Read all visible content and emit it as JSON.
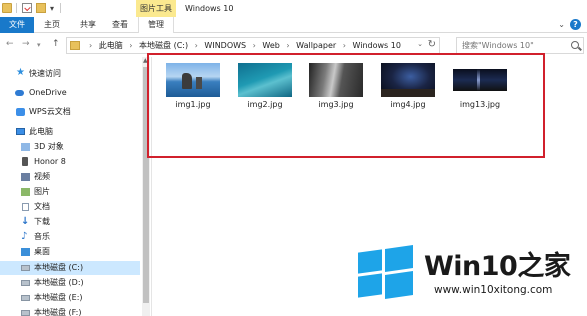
{
  "window": {
    "title": "Windows 10",
    "context_tab": "图片工具"
  },
  "quick_access": {
    "dropdown_glyph": "▾"
  },
  "ribbon": {
    "tabs": [
      {
        "label": "文件"
      },
      {
        "label": "主页"
      },
      {
        "label": "共享"
      },
      {
        "label": "查看"
      },
      {
        "label": "管理"
      }
    ],
    "expand_glyph": "⌄",
    "help_glyph": "?"
  },
  "nav_buttons": {
    "back": "←",
    "forward": "→",
    "recent": "▾",
    "up": "↑"
  },
  "address": {
    "crumbs": [
      "此电脑",
      "本地磁盘 (C:)",
      "WINDOWS",
      "Web",
      "Wallpaper",
      "Windows 10"
    ],
    "separator": "›",
    "dropdown_glyph": "⌄",
    "refresh_glyph": "↻"
  },
  "search": {
    "placeholder": "搜索\"Windows 10\""
  },
  "sidebar": {
    "items": [
      {
        "label": "快速访问",
        "icon": "star-icon"
      },
      {
        "label": "OneDrive",
        "icon": "cloud-icon"
      },
      {
        "label": "WPS云文档",
        "icon": "wps-cloud-icon"
      },
      {
        "label": "此电脑",
        "icon": "computer-icon"
      },
      {
        "label": "3D 对象",
        "icon": "cube-icon"
      },
      {
        "label": "Honor 8",
        "icon": "phone-icon"
      },
      {
        "label": "视频",
        "icon": "video-icon"
      },
      {
        "label": "图片",
        "icon": "pictures-icon"
      },
      {
        "label": "文档",
        "icon": "document-icon"
      },
      {
        "label": "下载",
        "icon": "download-icon"
      },
      {
        "label": "音乐",
        "icon": "music-icon"
      },
      {
        "label": "桌面",
        "icon": "desktop-icon"
      },
      {
        "label": "本地磁盘 (C:)",
        "icon": "drive-icon",
        "selected": true
      },
      {
        "label": "本地磁盘 (D:)",
        "icon": "drive-icon"
      },
      {
        "label": "本地磁盘 (E:)",
        "icon": "drive-icon"
      },
      {
        "label": "本地磁盘 (F:)",
        "icon": "drive-icon"
      }
    ],
    "star_glyph": "★",
    "download_glyph": "↓",
    "music_glyph": "♪",
    "scroll_up_glyph": "▲"
  },
  "files": [
    {
      "name": "img1.jpg"
    },
    {
      "name": "img2.jpg"
    },
    {
      "name": "img3.jpg"
    },
    {
      "name": "img4.jpg"
    },
    {
      "name": "img13.jpg"
    }
  ],
  "colors": {
    "accent": "#1979ca",
    "context_tab": "#fbe98f",
    "selection": "#cce8ff",
    "highlight_box": "#d1202c",
    "watermark_logo": "#1ea4e8"
  },
  "watermark": {
    "title": "Win10之家",
    "url": "www.win10xitong.com"
  }
}
